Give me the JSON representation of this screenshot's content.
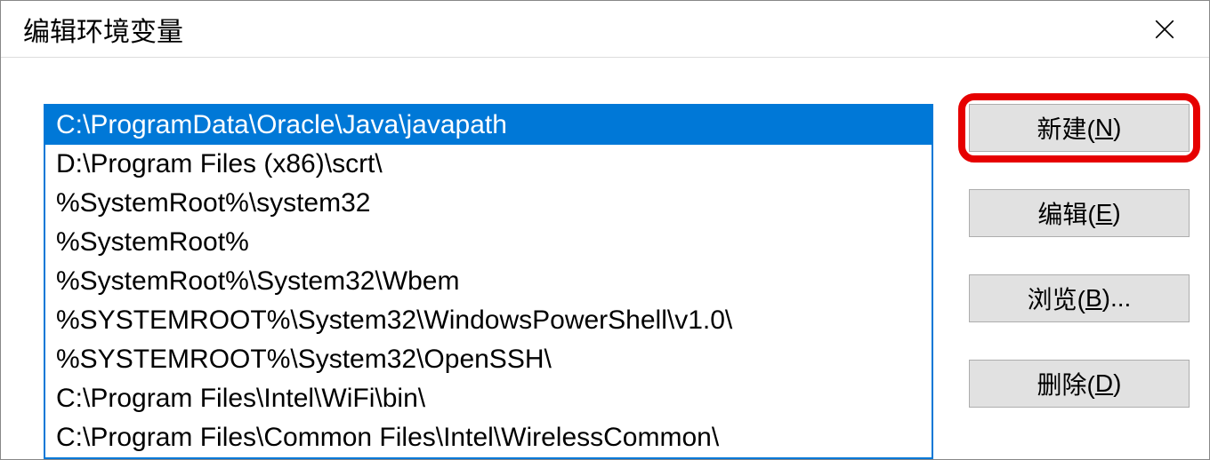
{
  "titlebar": {
    "title": "编辑环境变量"
  },
  "list": {
    "items": [
      "C:\\ProgramData\\Oracle\\Java\\javapath",
      "D:\\Program Files (x86)\\scrt\\",
      "%SystemRoot%\\system32",
      "%SystemRoot%",
      "%SystemRoot%\\System32\\Wbem",
      "%SYSTEMROOT%\\System32\\WindowsPowerShell\\v1.0\\",
      "%SYSTEMROOT%\\System32\\OpenSSH\\",
      "C:\\Program Files\\Intel\\WiFi\\bin\\",
      "C:\\Program Files\\Common Files\\Intel\\WirelessCommon\\"
    ],
    "selectedIndex": 0
  },
  "buttons": {
    "new": {
      "prefix": "新建(",
      "key": "N",
      "suffix": ")"
    },
    "edit": {
      "prefix": "编辑(",
      "key": "E",
      "suffix": ")"
    },
    "browse": {
      "prefix": "浏览(",
      "key": "B",
      "suffix": ")..."
    },
    "delete": {
      "prefix": "删除(",
      "key": "D",
      "suffix": ")"
    }
  }
}
